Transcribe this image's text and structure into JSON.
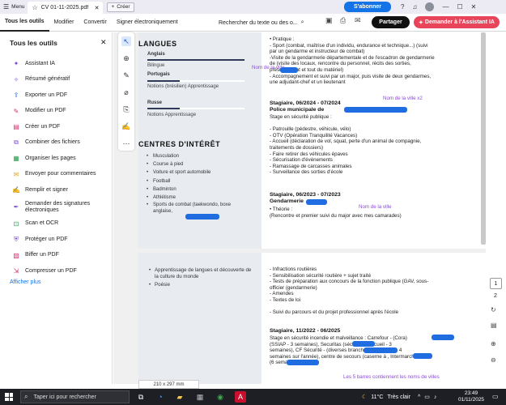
{
  "titlebar": {
    "menu_label": "Menu",
    "tab_title": "CV 01-11-2025.pdf",
    "new_tab_label": "Créer",
    "subscribe_label": "S'abonner"
  },
  "menubar": {
    "items": [
      "Tous les outils",
      "Modifier",
      "Convertir",
      "Signer électroniquement"
    ],
    "search_text": "Rechercher du texte ou des o...",
    "share_label": "Partager",
    "ai_label": "Demander à l'Assistant IA"
  },
  "sidebar": {
    "title": "Tous les outils",
    "items": [
      {
        "label": "Assistant IA",
        "icon": "ai-icon",
        "color": "#7a4bd6"
      },
      {
        "label": "Résumé génératif",
        "icon": "summary-icon",
        "color": "#7a4bd6"
      },
      {
        "label": "Exporter un PDF",
        "icon": "export-icon",
        "color": "#1f6de0"
      },
      {
        "label": "Modifier un PDF",
        "icon": "edit-icon",
        "color": "#d4306e"
      },
      {
        "label": "Créer un PDF",
        "icon": "create-icon",
        "color": "#d4306e"
      },
      {
        "label": "Combiner des fichiers",
        "icon": "combine-icon",
        "color": "#7a4bd6"
      },
      {
        "label": "Organiser les pages",
        "icon": "organize-icon",
        "color": "#2a9c48"
      },
      {
        "label": "Envoyer pour commentaires",
        "icon": "comment-icon",
        "color": "#e0a21f"
      },
      {
        "label": "Remplir et signer",
        "icon": "sign-icon",
        "color": "#7a4bd6"
      },
      {
        "label": "Demander des signatures électroniques",
        "icon": "signature-request-icon",
        "color": "#7a4bd6"
      },
      {
        "label": "Scan et OCR",
        "icon": "scan-icon",
        "color": "#2a9c48"
      },
      {
        "label": "Protéger un PDF",
        "icon": "protect-icon",
        "color": "#7a4bd6"
      },
      {
        "label": "Biffer un PDF",
        "icon": "redact-icon",
        "color": "#d4306e"
      },
      {
        "label": "Compresser un PDF",
        "icon": "compress-icon",
        "color": "#d4306e"
      }
    ],
    "more_label": "Afficher plus"
  },
  "page1": {
    "lang_heading": "LANGUES",
    "languages": [
      {
        "name": "Anglais",
        "level": "Bilingue",
        "fill": 1.0
      },
      {
        "name": "Portugais",
        "level": "Notions (brésilien) Apprentissage",
        "fill": 0.33
      },
      {
        "name": "Russe",
        "level": "Notions Apprentissage",
        "fill": 0.33
      }
    ],
    "ci_heading": "CENTRES D'INTÉRÊT",
    "interests": [
      "Musculation",
      "Course à pied",
      "Voiture et sport automobile",
      "Football",
      "Badminton",
      "Athlétisme",
      "Sports de combat (taekwondo, boxe anglaise,"
    ],
    "right_lines": [
      "• Pratique :",
      "- Sport (combat, maîtrise d'un individu, endurance et technique...) (suivi",
      "par un gendarme et instructeur de combat)",
      "-Visite de la gendarmerie départementale et de l'escadron de gendarmerie",
      "de         (visite des locaux, rencontre du personnel, récits des sorties,",
      "présentement et tout du matériel)",
      "- Accompagnement et suivi par un major, puis visite de deux gendarmes,",
      "une adjudant-chef et un lieutenant"
    ],
    "job1_title": "Stagiaire, 06/2024 - 07/2024",
    "job1_org": "Police municipale de",
    "job1_lines": [
      "Stage en sécurité publique :",
      "",
      "- Patrouille (pédestre, véhicule, vélo)",
      "- OTV (Opération Tranquilité Vacances)",
      "- Accueil (déclaration de vol, squat, perte d'un animal de compagnie,",
      "traitements de dossiers)",
      "- Faire retirer des véhicules épaves",
      "- Sécurisation d'événements",
      "- Ramassage de carcasses animales",
      "- Surveillance des sorties d'école"
    ],
    "job2_title": "Stagiaire, 06/2023 - 07/2023",
    "job2_org": "Gendarmerie",
    "job2_lines": [
      "• Théorie :",
      "(Rencontre et premier suivi du major avec mes camarades)"
    ],
    "notes": {
      "n1": "Nom de la ville",
      "n2": "Nom de la ville x2",
      "n3": "Nom de la ville"
    }
  },
  "page2": {
    "left_items": [
      "Apprentissage de langues et découverte de la culture du monde",
      "Poésie"
    ],
    "right_lines": [
      "- Infractions routières",
      "- Sensibilisation sécurité routière + sujet traité",
      "- Tests de préparation aux concours de la fonction publique (GAV, sous-",
      "officier (gendarmerie)",
      "- Amendes",
      "- Textes de loi",
      "",
      "- Suivi du parcours et du projet professionnel après l'école"
    ],
    "job3_title": "Stagiaire, 11/2022 - 06/2025",
    "job3_lines": [
      "Stage en sécurité incendie et malveillance : Carrefour -           (Cora)",
      "(SSIAP - 3 semaines), Securitas           (sécurité et accueil - 3",
      "semaines), CF Sécurité -          (diverses branches de sécurité - 4",
      "semaines sur l'année), centre de secours (caserne à       , Intermarché -",
      "              (6 semaines)"
    ],
    "note": "Les 5 barres contiennent les noms de villes"
  },
  "status": {
    "page_size": "210 x 297 mm",
    "current_page": "1",
    "total_pages": "2"
  },
  "taskbar": {
    "search_placeholder": "Taper ici pour rechercher",
    "temperature": "11°C",
    "weather": "Très clair",
    "time": "23:49",
    "date": "01/11/2025"
  }
}
